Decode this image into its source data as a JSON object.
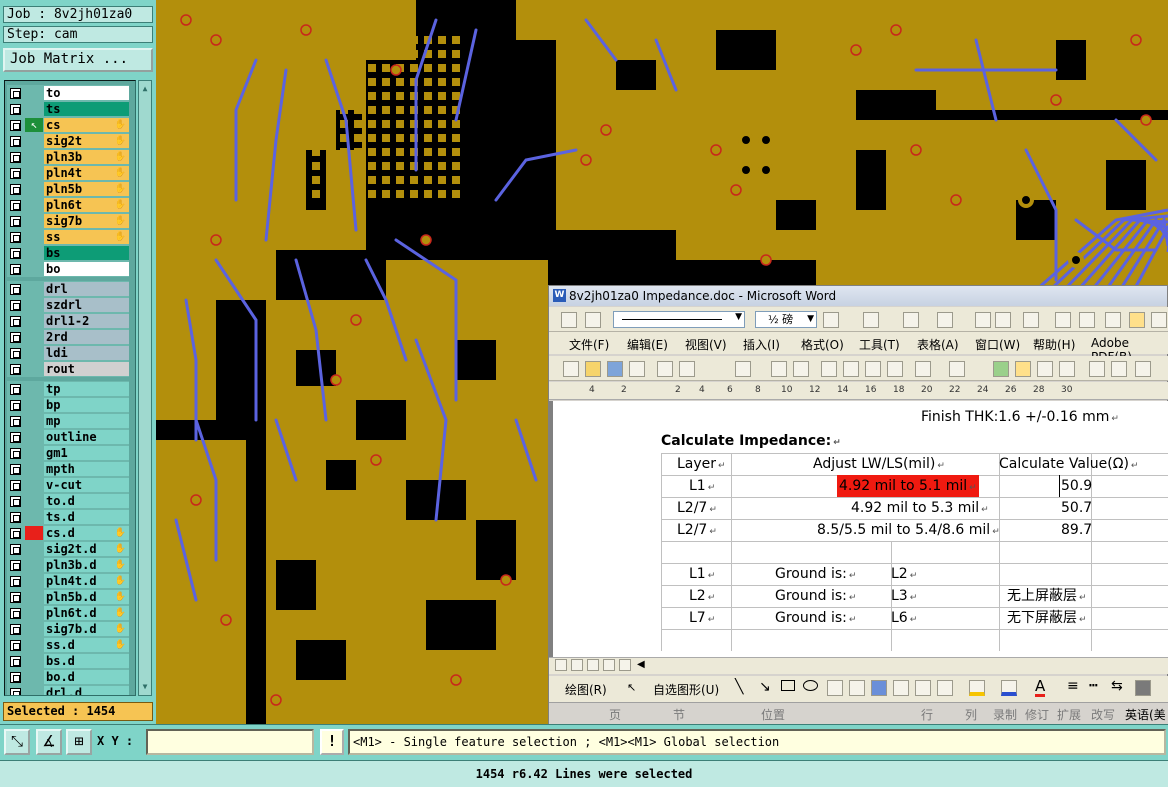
{
  "left_panel": {
    "job": "Job : 8v2jh01za0",
    "step": "Step: cam",
    "job_matrix_button": "Job Matrix ...",
    "groups": [
      {
        "layers": [
          {
            "name": "to",
            "color": "#ffffff",
            "hand": false,
            "work": false
          },
          {
            "name": "ts",
            "color": "#0d9c76",
            "hand": false,
            "work": false
          },
          {
            "name": "cs",
            "color": "#f6c453",
            "hand": true,
            "work": true
          },
          {
            "name": "sig2t",
            "color": "#f6c453",
            "hand": true,
            "work": false
          },
          {
            "name": "pln3b",
            "color": "#f6c453",
            "hand": true,
            "work": false
          },
          {
            "name": "pln4t",
            "color": "#f6c453",
            "hand": true,
            "work": false
          },
          {
            "name": "pln5b",
            "color": "#f6c453",
            "hand": true,
            "work": false
          },
          {
            "name": "pln6t",
            "color": "#f6c453",
            "hand": true,
            "work": false
          },
          {
            "name": "sig7b",
            "color": "#f6c453",
            "hand": true,
            "work": false
          },
          {
            "name": "ss",
            "color": "#f6c453",
            "hand": true,
            "work": false
          },
          {
            "name": "bs",
            "color": "#0d9c76",
            "hand": false,
            "work": false
          },
          {
            "name": "bo",
            "color": "#ffffff",
            "hand": false,
            "work": false
          }
        ]
      },
      {
        "layers": [
          {
            "name": "drl",
            "color": "#a8bfc9",
            "hand": false,
            "work": false
          },
          {
            "name": "szdrl",
            "color": "#a8bfc9",
            "hand": false,
            "work": false
          },
          {
            "name": "drl1-2",
            "color": "#a8bfc9",
            "hand": false,
            "work": false
          },
          {
            "name": "2rd",
            "color": "#a8bfc9",
            "hand": false,
            "work": false
          },
          {
            "name": "ldi",
            "color": "#a8bfc9",
            "hand": false,
            "work": false
          },
          {
            "name": "rout",
            "color": "#d0d0d0",
            "hand": false,
            "work": false
          }
        ]
      },
      {
        "layers": [
          {
            "name": "tp",
            "color": "#7fd4c8",
            "hand": false,
            "work": false
          },
          {
            "name": "bp",
            "color": "#7fd4c8",
            "hand": false,
            "work": false
          },
          {
            "name": "mp",
            "color": "#7fd4c8",
            "hand": false,
            "work": false
          },
          {
            "name": "outline",
            "color": "#7fd4c8",
            "hand": false,
            "work": false
          },
          {
            "name": "gm1",
            "color": "#7fd4c8",
            "hand": false,
            "work": false
          },
          {
            "name": "mpth",
            "color": "#7fd4c8",
            "hand": false,
            "work": false
          },
          {
            "name": "v-cut",
            "color": "#7fd4c8",
            "hand": false,
            "work": false
          },
          {
            "name": "to.d",
            "color": "#7fd4c8",
            "hand": false,
            "work": false
          },
          {
            "name": "ts.d",
            "color": "#7fd4c8",
            "hand": false,
            "work": false
          },
          {
            "name": "cs.d",
            "color": "#7fd4c8",
            "hand": true,
            "work": false,
            "marker": "#e8201a"
          },
          {
            "name": "sig2t.d",
            "color": "#7fd4c8",
            "hand": true,
            "work": false
          },
          {
            "name": "pln3b.d",
            "color": "#7fd4c8",
            "hand": true,
            "work": false
          },
          {
            "name": "pln4t.d",
            "color": "#7fd4c8",
            "hand": true,
            "work": false
          },
          {
            "name": "pln5b.d",
            "color": "#7fd4c8",
            "hand": true,
            "work": false
          },
          {
            "name": "pln6t.d",
            "color": "#7fd4c8",
            "hand": true,
            "work": false
          },
          {
            "name": "sig7b.d",
            "color": "#7fd4c8",
            "hand": true,
            "work": false
          },
          {
            "name": "ss.d",
            "color": "#7fd4c8",
            "hand": true,
            "work": false
          },
          {
            "name": "bs.d",
            "color": "#7fd4c8",
            "hand": false,
            "work": false
          },
          {
            "name": "bo.d",
            "color": "#7fd4c8",
            "hand": false,
            "work": false
          },
          {
            "name": "drl.d",
            "color": "#7fd4c8",
            "hand": false,
            "work": false
          }
        ]
      }
    ],
    "selected": "Selected : 1454"
  },
  "colors": {
    "copper": "#b38f0c",
    "board_black": "#000000",
    "trace_blue": "#5b63e0",
    "pad_ring_red": "#c8271c",
    "highlight_magenta": "#f07ee8",
    "word_selection_red": "#f01a10"
  },
  "word": {
    "title": "8v2jh01za0 Impedance.doc - Microsoft Word",
    "icon": "W",
    "toolbar_font_size": "½ 磅",
    "menu": [
      "文件(F)",
      "编辑(E)",
      "视图(V)",
      "插入(I)",
      "格式(O)",
      "工具(T)",
      "表格(A)",
      "窗口(W)",
      "帮助(H)",
      "Adobe PDF(B)"
    ],
    "ruler_marks": [
      "4",
      "2",
      "2",
      "4",
      "6",
      "8",
      "10",
      "12",
      "14",
      "16",
      "18",
      "20",
      "22",
      "24",
      "26",
      "28",
      "30"
    ],
    "finish_thk": "Finish THK:1.6 +/-0.16 mm",
    "calc_title": "Calculate Impedance:",
    "headers": [
      "Layer",
      "Adjust LW/LS(mil)",
      "Calculate Value(Ω)"
    ],
    "rows": [
      {
        "layer": "L1",
        "adjust": "4.92 mil to  5.1 mil",
        "value": "50.9",
        "highlight": true
      },
      {
        "layer": "L2/7",
        "adjust": "4.92 mil to  5.3 mil",
        "value": "50.7",
        "highlight": false
      },
      {
        "layer": "L2/7",
        "adjust": "8.5/5.5 mil to  5.4/8.6 mil",
        "value": "89.7",
        "highlight": false
      }
    ],
    "ground_rows": [
      {
        "layer": "L1",
        "label": "Ground is:",
        "ground": "L2",
        "note": ""
      },
      {
        "layer": "L2",
        "label": "Ground is:",
        "ground": "L3",
        "note": "无上屏蔽层"
      },
      {
        "layer": "L7",
        "label": "Ground is:",
        "ground": "L6",
        "note": "无下屏蔽层"
      }
    ],
    "draw_label": "绘图(R)",
    "autoshape_label": "自选图形(U)",
    "status": [
      "页",
      "节",
      "位置",
      "行",
      "列",
      "录制",
      "修订",
      "扩展",
      "改写",
      "英语(美"
    ]
  },
  "bottom": {
    "xy_label": "X Y :",
    "xy_value": "",
    "alert": "!",
    "hint": "<M1> - Single feature selection ; <M1><M1> Global selection",
    "status": "1454 r6.42 Lines were selected"
  }
}
